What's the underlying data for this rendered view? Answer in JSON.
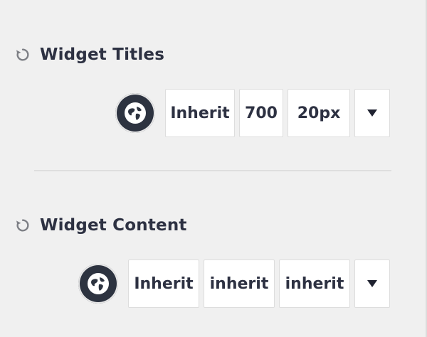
{
  "sections": [
    {
      "title": "Widget Titles",
      "font_family": "Inherit",
      "font_weight": "700",
      "font_size": "20px",
      "reset_icon": "reset-icon",
      "globe_icon": "globe-icon",
      "dropdown_icon": "caret-down-icon"
    },
    {
      "title": "Widget Content",
      "font_family": "Inherit",
      "font_weight": "inherit",
      "font_size": "inherit",
      "reset_icon": "reset-icon",
      "globe_icon": "globe-icon",
      "dropdown_icon": "caret-down-icon"
    }
  ],
  "colors": {
    "background": "#f0f0f0",
    "text": "#2d3142",
    "globe_bg": "#2d3340",
    "box_bg": "#ffffff"
  }
}
